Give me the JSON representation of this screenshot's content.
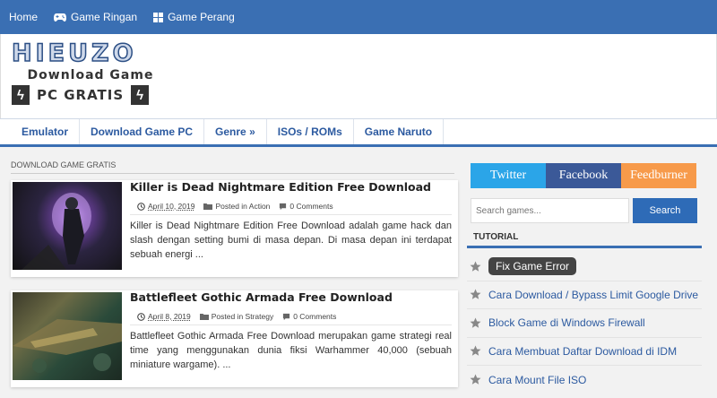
{
  "top_nav": [
    {
      "label": "Home",
      "icon": ""
    },
    {
      "label": "Game Ringan",
      "icon": "gamepad-icon"
    },
    {
      "label": "Game Perang",
      "icon": "windows-icon"
    }
  ],
  "logo": {
    "brand": "HIEUZO",
    "line1": "Download Game",
    "line2": "PC GRATIS"
  },
  "sub_nav": [
    "Emulator",
    "Download Game PC",
    "Genre »",
    "ISOs / ROMs",
    "Game Naruto"
  ],
  "main": {
    "section_label": "DOWNLOAD GAME GRATIS",
    "posts": [
      {
        "title": "Killer is Dead Nightmare Edition Free Download",
        "date": "April 10, 2019",
        "category": "Posted in Action",
        "comments": "0 Comments",
        "excerpt": "Killer is Dead Nightmare Edition Free Download adalah game hack dan slash dengan setting bumi di masa depan. Di masa depan ini terdapat sebuah energi ..."
      },
      {
        "title": "Battlefleet Gothic Armada Free Download",
        "date": "April 8, 2019",
        "category": "Posted in Strategy",
        "comments": "0 Comments",
        "excerpt": "Battlefleet Gothic Armada Free Download merupakan game strategi real time yang menggunakan dunia fiksi Warhammer 40,000 (sebuah miniature wargame). ..."
      }
    ]
  },
  "sidebar": {
    "social": [
      "Twitter",
      "Facebook",
      "Feedburner"
    ],
    "search_placeholder": "Search games...",
    "search_button": "Search",
    "widget_title": "TUTORIAL",
    "tutorials": [
      "Fix Game Error",
      "Cara Download / Bypass Limit Google Drive",
      "Block Game di Windows Firewall",
      "Cara Membuat Daftar Download di IDM",
      "Cara Mount File ISO"
    ]
  },
  "colors": {
    "nav_blue": "#3a6fb3",
    "twitter": "#2ba5e8",
    "facebook": "#3b5998",
    "feedburner": "#f79a4a",
    "link": "#2c5aa0"
  }
}
